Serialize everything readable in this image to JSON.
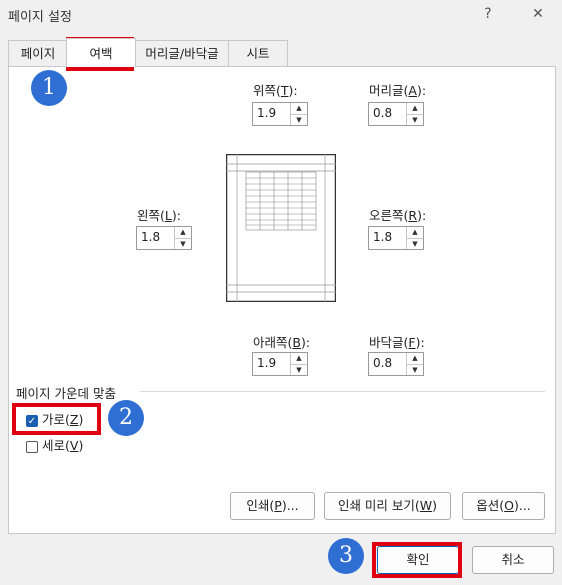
{
  "window": {
    "title": "페이지 설정",
    "help": "?",
    "close": "✕"
  },
  "tabs": [
    {
      "label": "페이지",
      "active": false
    },
    {
      "label": "여백",
      "active": true
    },
    {
      "label": "머리글/바닥글",
      "active": false
    },
    {
      "label": "시트",
      "active": false
    }
  ],
  "margins": {
    "top": {
      "label": "위쪽(",
      "key": "T",
      "tail": "):",
      "value": "1.9"
    },
    "header": {
      "label": "머리글(",
      "key": "A",
      "tail": "):",
      "value": "0.8"
    },
    "left": {
      "label": "왼쪽(",
      "key": "L",
      "tail": "):",
      "value": "1.8"
    },
    "right": {
      "label": "오른쪽(",
      "key": "R",
      "tail": "):",
      "value": "1.8"
    },
    "bottom": {
      "label": "아래쪽(",
      "key": "B",
      "tail": "):",
      "value": "1.9"
    },
    "footer": {
      "label": "바닥글(",
      "key": "F",
      "tail": "):",
      "value": "0.8"
    }
  },
  "center": {
    "group_label": "페이지 가운데 맞춤",
    "horizontal": {
      "label": "가로(",
      "key": "Z",
      "tail": ")",
      "checked": true
    },
    "vertical": {
      "label": "세로(",
      "key": "V",
      "tail": ")",
      "checked": false
    }
  },
  "buttons": {
    "print": {
      "label": "인쇄(",
      "key": "P",
      "tail": ")..."
    },
    "preview": {
      "label": "인쇄 미리 보기(",
      "key": "W",
      "tail": ")"
    },
    "options": {
      "label": "옵션(",
      "key": "O",
      "tail": ")..."
    },
    "ok": "확인",
    "cancel": "취소"
  },
  "badges": [
    "1",
    "2",
    "3"
  ],
  "colors": {
    "highlight": "#e00012",
    "badge": "#2f6fd3",
    "check": "#1a5fb4"
  }
}
